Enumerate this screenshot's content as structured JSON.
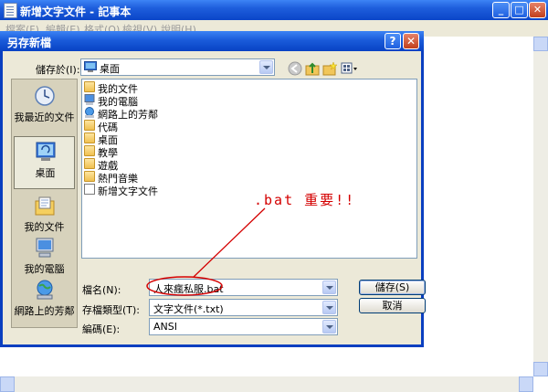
{
  "notepad": {
    "title": "新增文字文件 - 記事本",
    "menu": [
      "檔案(F)",
      "編輯(E)",
      "格式(O)",
      "檢視(V)",
      "說明(H)"
    ]
  },
  "dialog": {
    "title": "另存新檔",
    "save_in_label": "儲存於(I):",
    "save_in_value": "桌面",
    "places": [
      "我最近的文件",
      "桌面",
      "我的文件",
      "我的電腦",
      "網路上的芳鄰"
    ],
    "selected_place": "桌面",
    "files": [
      "我的文件",
      "我的電腦",
      "網路上的芳鄰",
      "代碼",
      "桌面",
      "教學",
      "遊戲",
      "熱門音樂",
      "新增文字文件"
    ],
    "filename_label": "檔名(N):",
    "filename_value": "人來瘋私服.bat",
    "filetype_label": "存檔類型(T):",
    "filetype_value": "文字文件(*.txt)",
    "encoding_label": "編碼(E):",
    "encoding_value": "ANSI",
    "save_button": "儲存(S)",
    "cancel_button": "取消"
  },
  "annotation": {
    "text": ".bat  重要!!",
    "color": "#d40000"
  }
}
